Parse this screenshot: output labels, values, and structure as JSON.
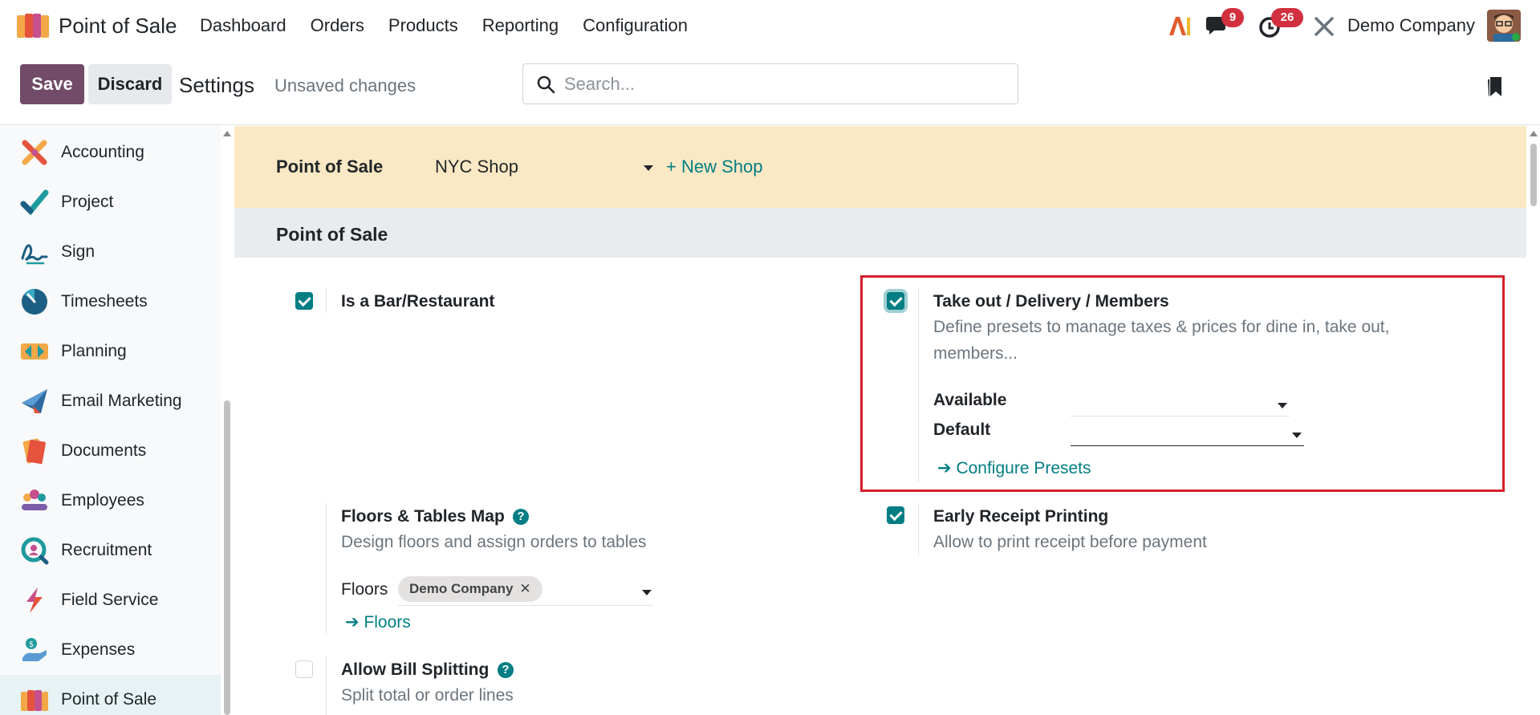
{
  "navbar": {
    "app_name": "Point of Sale",
    "menu": [
      "Dashboard",
      "Orders",
      "Products",
      "Reporting",
      "Configuration"
    ],
    "chat_count": "9",
    "activity_count": "26",
    "company": "Demo Company"
  },
  "control_panel": {
    "save_label": "Save",
    "discard_label": "Discard",
    "title": "Settings",
    "status": "Unsaved changes",
    "search_placeholder": "Search..."
  },
  "sidebar": {
    "items": [
      {
        "label": "Accounting",
        "icon": "accounting-icon"
      },
      {
        "label": "Project",
        "icon": "project-icon"
      },
      {
        "label": "Sign",
        "icon": "sign-icon"
      },
      {
        "label": "Timesheets",
        "icon": "timesheets-icon"
      },
      {
        "label": "Planning",
        "icon": "planning-icon"
      },
      {
        "label": "Email Marketing",
        "icon": "email-marketing-icon"
      },
      {
        "label": "Documents",
        "icon": "documents-icon"
      },
      {
        "label": "Employees",
        "icon": "employees-icon"
      },
      {
        "label": "Recruitment",
        "icon": "recruitment-icon"
      },
      {
        "label": "Field Service",
        "icon": "field-service-icon"
      },
      {
        "label": "Expenses",
        "icon": "expenses-icon"
      },
      {
        "label": "Point of Sale",
        "icon": "point-of-sale-icon",
        "active": true
      }
    ]
  },
  "main": {
    "shop_bar": {
      "label": "Point of Sale",
      "selected_shop": "NYC Shop",
      "new_shop_link": "+ New Shop"
    },
    "section_title": "Point of Sale",
    "settings": {
      "bar_restaurant": {
        "title": "Is a Bar/Restaurant",
        "checked": true
      },
      "takeout": {
        "title": "Take out / Delivery / Members",
        "description": "Define presets to manage taxes & prices for dine in, take out, members...",
        "checked": true,
        "available_label": "Available",
        "available_value": "",
        "default_label": "Default",
        "default_value": "",
        "configure_link": "Configure Presets"
      },
      "floors_map": {
        "title": "Floors & Tables Map",
        "description": "Design floors and assign orders to tables",
        "floors_label": "Floors",
        "floors_tag": "Demo Company",
        "floors_link": "Floors"
      },
      "early_receipt": {
        "title": "Early Receipt Printing",
        "description": "Allow to print receipt before payment",
        "checked": true
      },
      "bill_splitting": {
        "title": "Allow Bill Splitting",
        "description": "Split total or order lines",
        "checked": false
      }
    }
  },
  "colors": {
    "primary": "#714b67",
    "accent": "#017e84",
    "badge": "#d2303f",
    "highlight": "#d6202a",
    "shop_bar": "#fbe8c4"
  }
}
